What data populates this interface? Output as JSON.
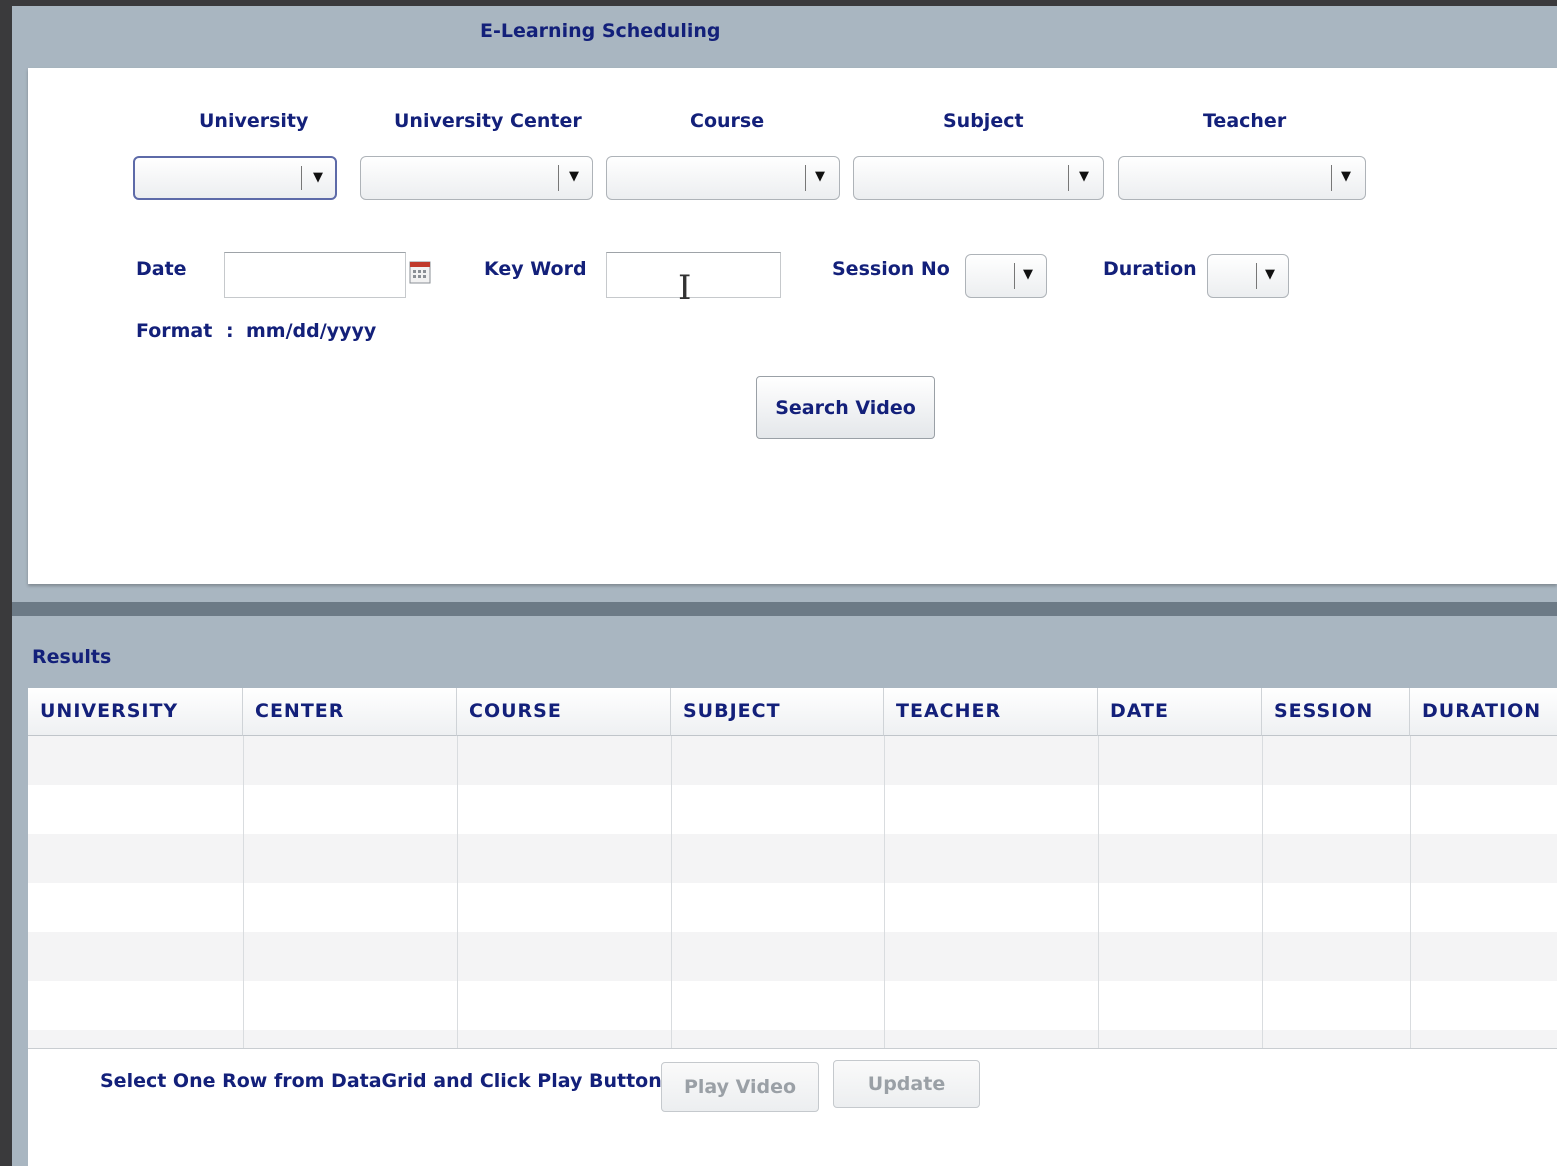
{
  "search_panel": {
    "title": "E-Learning Scheduling",
    "filters": {
      "university_label": "University",
      "center_label": "University Center",
      "course_label": "Course",
      "subject_label": "Subject",
      "teacher_label": "Teacher"
    },
    "date_label": "Date",
    "keyword_label": "Key Word",
    "session_label": "Session No",
    "duration_label": "Duration",
    "format_label": "Format",
    "format_separator": ":",
    "format_value": "mm/dd/yyyy",
    "search_button": "Search Video",
    "dropdown_arrow": "▼"
  },
  "results": {
    "title": "Results",
    "columns": [
      "UNIVERSITY",
      "CENTER",
      "COURSE",
      "SUBJECT",
      "TEACHER",
      "DATE",
      "SESSION",
      "DURATION"
    ],
    "rows": [],
    "instruction": "Select One Row from DataGrid and Click Play Button",
    "play_button": "Play Video",
    "update_button": "Update"
  },
  "icons": [
    "calendar-icon",
    "text-cursor-icon",
    "dropdown-arrow-icon"
  ],
  "colors": {
    "label_text": "#13207a",
    "panel_background": "#a9b6c1",
    "disabled_text": "#9aa0a6"
  }
}
